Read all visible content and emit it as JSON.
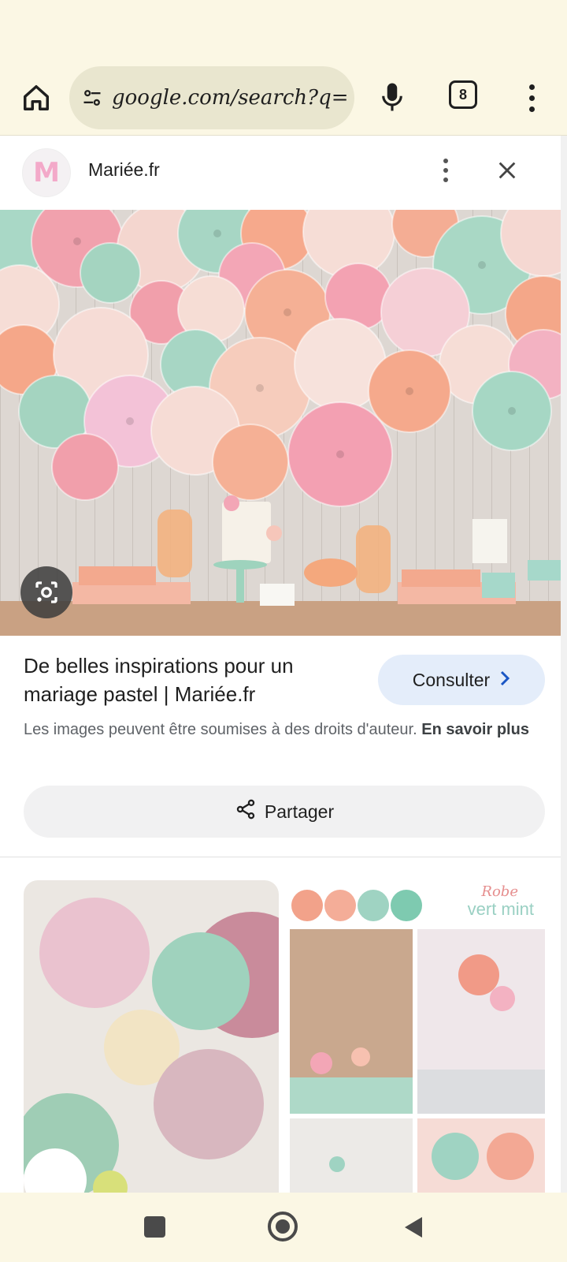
{
  "toolbar": {
    "url": "google.com/search?q=",
    "tab_count": "8"
  },
  "panel": {
    "logo_letter": "M",
    "site_name": "Mariée.fr"
  },
  "result": {
    "title": "De belles inspirations pour un mariage pastel | Mariée.fr",
    "consult_label": "Consulter",
    "copyright_text": "Les images peuvent être soumises à des droits d'auteur.",
    "learn_more": "En savoir plus",
    "share_label": "Partager"
  },
  "thumbnails": {
    "thumb2_caption_line1": "Robe",
    "thumb2_caption_line2": "vert mint"
  },
  "colors": {
    "chrome_bg": "#fbf7e4",
    "omnibox_bg": "#e9e6cf",
    "consult_bg": "#e4edfa",
    "share_bg": "#f1f1f2",
    "mint": "#9bd0bd",
    "peach": "#f5a58a",
    "pink": "#f3a0b0"
  },
  "icons": {
    "home": "home-icon",
    "tune": "tune-icon",
    "mic": "mic-icon",
    "tabs": "tab-switcher-icon",
    "menu": "more-vert-icon",
    "close": "close-icon",
    "lens": "google-lens-icon",
    "chevron": "chevron-right-icon",
    "share": "share-icon"
  }
}
